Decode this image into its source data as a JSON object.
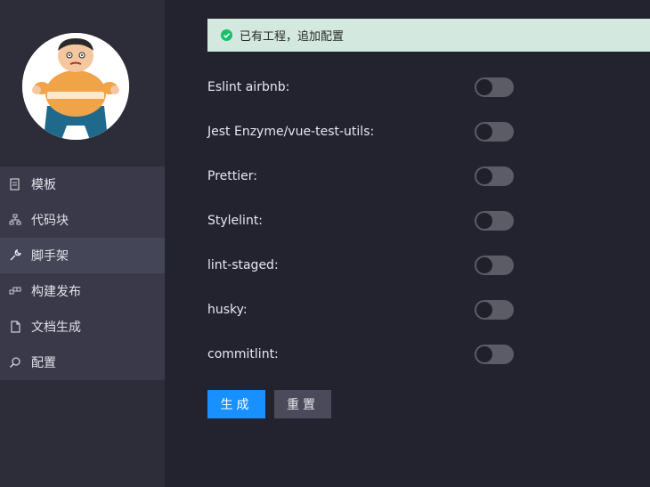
{
  "sidebar": {
    "avatar_alt": "avatar",
    "items": [
      {
        "label": "模板",
        "icon": "document-icon",
        "active": false
      },
      {
        "label": "代码块",
        "icon": "sitemap-icon",
        "active": false
      },
      {
        "label": "脚手架",
        "icon": "wrench-icon",
        "active": true
      },
      {
        "label": "构建发布",
        "icon": "blocks-icon",
        "active": false
      },
      {
        "label": "文档生成",
        "icon": "file-icon",
        "active": false
      },
      {
        "label": "配置",
        "icon": "search-icon",
        "active": false
      }
    ]
  },
  "alert": {
    "text": "已有工程，追加配置",
    "icon": "check-circle-icon",
    "color": "#19be6b"
  },
  "form": {
    "rows": [
      {
        "label": "Eslint airbnb:",
        "enabled": false
      },
      {
        "label": "Jest Enzyme/vue-test-utils:",
        "enabled": false
      },
      {
        "label": "Prettier:",
        "enabled": false
      },
      {
        "label": "Stylelint:",
        "enabled": false
      },
      {
        "label": "lint-staged:",
        "enabled": false
      },
      {
        "label": "husky:",
        "enabled": false
      },
      {
        "label": "commitlint:",
        "enabled": false
      }
    ]
  },
  "buttons": {
    "generate": "生成",
    "reset": "重置"
  },
  "colors": {
    "primary": "#1890ff",
    "background": "#23232f",
    "sidebar": "#2d2d3a"
  }
}
